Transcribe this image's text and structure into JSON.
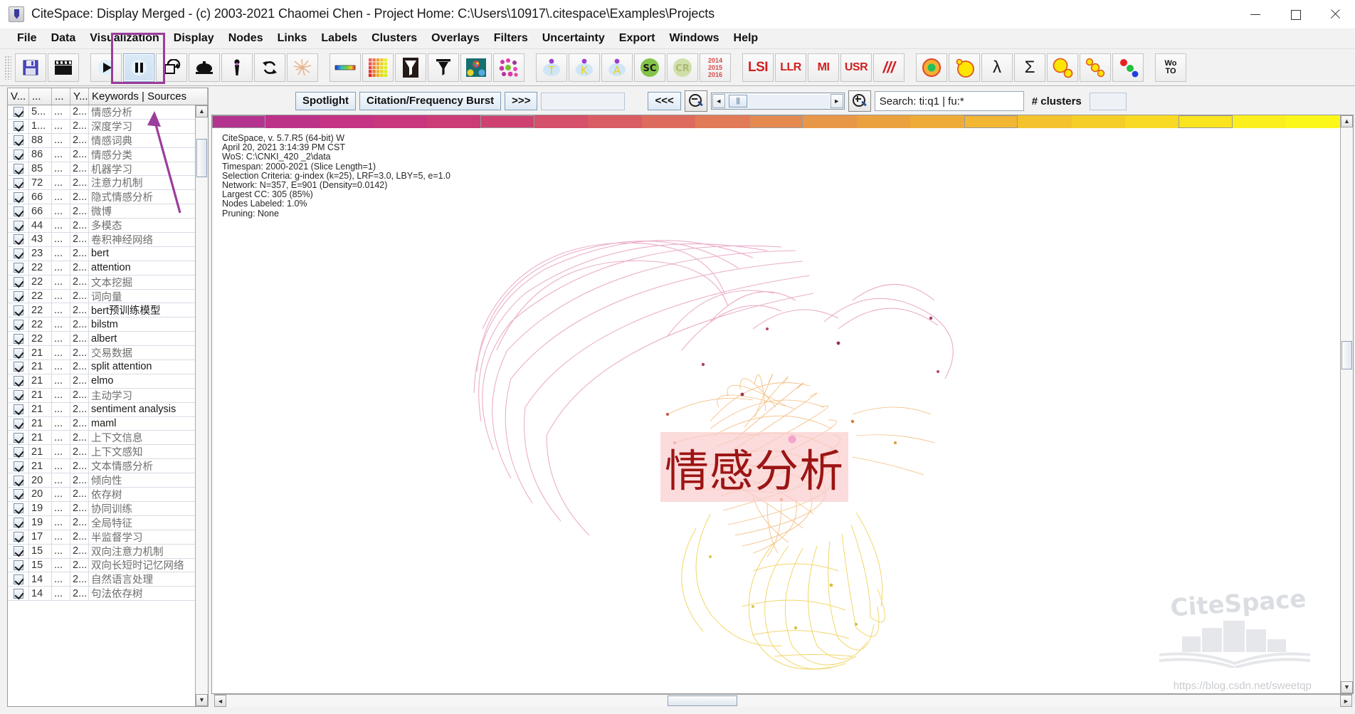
{
  "window": {
    "title": "CiteSpace: Display Merged - (c) 2003-2021 Chaomei Chen - Project Home: C:\\Users\\10917\\.citespace\\Examples\\Projects",
    "app_icon": "citespace-app-icon",
    "minimize": "–",
    "maximize": "□",
    "close": "✕"
  },
  "menubar": {
    "items": [
      {
        "label": "File"
      },
      {
        "label": "Data"
      },
      {
        "label": "Visualization"
      },
      {
        "label": "Display"
      },
      {
        "label": "Nodes"
      },
      {
        "label": "Links"
      },
      {
        "label": "Labels"
      },
      {
        "label": "Clusters"
      },
      {
        "label": "Overlays"
      },
      {
        "label": "Filters"
      },
      {
        "label": "Uncertainty"
      },
      {
        "label": "Export"
      },
      {
        "label": "Windows"
      },
      {
        "label": "Help"
      }
    ]
  },
  "toolbar": {
    "buttons": [
      {
        "name": "save-icon",
        "kind": "save"
      },
      {
        "name": "movie-clapper-icon",
        "kind": "movie"
      },
      {
        "name": "play-icon",
        "kind": "play"
      },
      {
        "name": "pause-icon",
        "kind": "pause",
        "pressed": true
      },
      {
        "name": "rotate-loop-icon",
        "kind": "loop"
      },
      {
        "name": "dome-icon",
        "kind": "dome"
      },
      {
        "name": "pin-icon",
        "kind": "pin"
      },
      {
        "name": "refresh-icon",
        "kind": "refresh"
      },
      {
        "name": "burst-starburst-icon",
        "kind": "starburst"
      },
      {
        "name": "color-gradient-bar-icon",
        "kind": "gradient"
      },
      {
        "name": "color-matrix-icon",
        "kind": "matrix"
      },
      {
        "name": "timeline-filled-icon",
        "kind": "funnel-filled"
      },
      {
        "name": "timeline-outline-icon",
        "kind": "funnel-outline"
      },
      {
        "name": "cluster-circles-icon",
        "kind": "clusters"
      },
      {
        "name": "network-dots-icon",
        "kind": "netdots"
      },
      {
        "name": "tree-t-icon",
        "label": "T"
      },
      {
        "name": "tree-k-icon",
        "label": "K"
      },
      {
        "name": "tree-a-icon",
        "label": "A"
      },
      {
        "name": "sc-badge-icon",
        "label": "SC"
      },
      {
        "name": "cr-badge-icon",
        "label": "CR"
      },
      {
        "name": "year-range-icon",
        "label": "2014\n2015\n2016"
      },
      {
        "name": "lsi-button",
        "label": "LSI"
      },
      {
        "name": "llr-button",
        "label": "LLR"
      },
      {
        "name": "mi-button",
        "label": "MI"
      },
      {
        "name": "usr-button",
        "label": "USR"
      },
      {
        "name": "slashes-button",
        "label": "///"
      },
      {
        "name": "node-ring-icon",
        "kind": "ring"
      },
      {
        "name": "node-circle-icon",
        "kind": "circle"
      },
      {
        "name": "lambda-button",
        "label": "λ"
      },
      {
        "name": "sigma-button",
        "label": "Σ"
      },
      {
        "name": "two-circles-icon",
        "kind": "twocircles"
      },
      {
        "name": "chain-circles-icon",
        "kind": "chain"
      },
      {
        "name": "rgb-dots-icon",
        "kind": "rgbdots"
      },
      {
        "name": "wos-toggle-button",
        "label": "Wo\nTO"
      }
    ]
  },
  "table": {
    "headers": [
      "V...",
      "...",
      "...",
      "Y...",
      "Keywords | Sources"
    ],
    "rows": [
      {
        "checked": true,
        "freq": "5...",
        "c2": "...",
        "year": "2...",
        "keyword": "情感分析",
        "latin": false
      },
      {
        "checked": true,
        "freq": "1...",
        "c2": "...",
        "year": "2...",
        "keyword": "深度学习",
        "latin": false
      },
      {
        "checked": true,
        "freq": "88",
        "c2": "...",
        "year": "2...",
        "keyword": "情感词典",
        "latin": false
      },
      {
        "checked": true,
        "freq": "86",
        "c2": "...",
        "year": "2...",
        "keyword": "情感分类",
        "latin": false
      },
      {
        "checked": true,
        "freq": "85",
        "c2": "...",
        "year": "2...",
        "keyword": "机器学习",
        "latin": false
      },
      {
        "checked": true,
        "freq": "72",
        "c2": "...",
        "year": "2...",
        "keyword": "注意力机制",
        "latin": false
      },
      {
        "checked": true,
        "freq": "66",
        "c2": "...",
        "year": "2...",
        "keyword": "隐式情感分析",
        "latin": false
      },
      {
        "checked": true,
        "freq": "66",
        "c2": "...",
        "year": "2...",
        "keyword": "微博",
        "latin": false
      },
      {
        "checked": true,
        "freq": "44",
        "c2": "...",
        "year": "2...",
        "keyword": "多模态",
        "latin": false
      },
      {
        "checked": true,
        "freq": "43",
        "c2": "...",
        "year": "2...",
        "keyword": "卷积神经网络",
        "latin": false
      },
      {
        "checked": true,
        "freq": "23",
        "c2": "...",
        "year": "2...",
        "keyword": "bert",
        "latin": true
      },
      {
        "checked": true,
        "freq": "22",
        "c2": "...",
        "year": "2...",
        "keyword": "attention",
        "latin": true
      },
      {
        "checked": true,
        "freq": "22",
        "c2": "...",
        "year": "2...",
        "keyword": "文本挖掘",
        "latin": false
      },
      {
        "checked": true,
        "freq": "22",
        "c2": "...",
        "year": "2...",
        "keyword": "词向量",
        "latin": false
      },
      {
        "checked": true,
        "freq": "22",
        "c2": "...",
        "year": "2...",
        "keyword": "bert预训练模型",
        "latin": true
      },
      {
        "checked": true,
        "freq": "22",
        "c2": "...",
        "year": "2...",
        "keyword": "bilstm",
        "latin": true
      },
      {
        "checked": true,
        "freq": "22",
        "c2": "...",
        "year": "2...",
        "keyword": "albert",
        "latin": true
      },
      {
        "checked": true,
        "freq": "21",
        "c2": "...",
        "year": "2...",
        "keyword": "交易数据",
        "latin": false
      },
      {
        "checked": true,
        "freq": "21",
        "c2": "...",
        "year": "2...",
        "keyword": "split attention",
        "latin": true
      },
      {
        "checked": true,
        "freq": "21",
        "c2": "...",
        "year": "2...",
        "keyword": "elmo",
        "latin": true
      },
      {
        "checked": true,
        "freq": "21",
        "c2": "...",
        "year": "2...",
        "keyword": "主动学习",
        "latin": false
      },
      {
        "checked": true,
        "freq": "21",
        "c2": "...",
        "year": "2...",
        "keyword": "sentiment analysis",
        "latin": true
      },
      {
        "checked": true,
        "freq": "21",
        "c2": "...",
        "year": "2...",
        "keyword": "maml",
        "latin": true
      },
      {
        "checked": true,
        "freq": "21",
        "c2": "...",
        "year": "2...",
        "keyword": "上下文信息",
        "latin": false
      },
      {
        "checked": true,
        "freq": "21",
        "c2": "...",
        "year": "2...",
        "keyword": "上下文感知",
        "latin": false
      },
      {
        "checked": true,
        "freq": "21",
        "c2": "...",
        "year": "2...",
        "keyword": "文本情感分析",
        "latin": false
      },
      {
        "checked": true,
        "freq": "20",
        "c2": "...",
        "year": "2...",
        "keyword": "倾向性",
        "latin": false
      },
      {
        "checked": true,
        "freq": "20",
        "c2": "...",
        "year": "2...",
        "keyword": "依存树",
        "latin": false
      },
      {
        "checked": true,
        "freq": "19",
        "c2": "...",
        "year": "2...",
        "keyword": "协同训练",
        "latin": false
      },
      {
        "checked": true,
        "freq": "19",
        "c2": "...",
        "year": "2...",
        "keyword": "全局特征",
        "latin": false
      },
      {
        "checked": true,
        "freq": "17",
        "c2": "...",
        "year": "2...",
        "keyword": "半监督学习",
        "latin": false
      },
      {
        "checked": true,
        "freq": "15",
        "c2": "...",
        "year": "2...",
        "keyword": "双向注意力机制",
        "latin": false
      },
      {
        "checked": true,
        "freq": "15",
        "c2": "...",
        "year": "2...",
        "keyword": "双向长短时记忆网络",
        "latin": false
      },
      {
        "checked": true,
        "freq": "14",
        "c2": "...",
        "year": "2...",
        "keyword": "自然语言处理",
        "latin": false
      },
      {
        "checked": true,
        "freq": "14",
        "c2": "...",
        "year": "2...",
        "keyword": "句法依存树",
        "latin": false
      }
    ]
  },
  "controlbar": {
    "spotlight_label": "Spotlight",
    "burst_label": "Citation/Frequency Burst",
    "forward_label": ">>>",
    "back_label": "<<<",
    "field_value": "",
    "zoom_out_icon": "zoom-out-icon",
    "zoom_in_icon": "zoom-in-icon",
    "slider_left_arrow": "◄",
    "slider_right_arrow": "►",
    "search_value": "Search: ti:q1 | fu:*",
    "clusters_label": "# clusters",
    "clusters_value": ""
  },
  "graph": {
    "info_lines": [
      "CiteSpace, v. 5.7.R5 (64-bit) W",
      "April 20, 2021 3:14:39 PM CST",
      "WoS: C:\\CNKI_420 _2\\data",
      "Timespan: 2000-2021 (Slice Length=1)",
      "Selection Criteria: g-index (k=25), LRF=3.0, LBY=5, e=1.0",
      "Network: N=357, E=901 (Density=0.0142)",
      "Largest CC: 305 (85%)",
      "Nodes Labeled: 1.0%",
      "Pruning: None"
    ],
    "node_label": "情感分析",
    "watermark_text": "CiteSpace",
    "csdn_watermark": "https://blog.csdn.net/sweetqp",
    "spectrum_colors": [
      "#b4338f",
      "#bd3289",
      "#c43384",
      "#c8377d",
      "#cb3c76",
      "#cf4170",
      "#d5506b",
      "#d95b64",
      "#dc6b5e",
      "#e07a57",
      "#e58a4f",
      "#e89647",
      "#eca13f",
      "#efab38",
      "#f2b633",
      "#f4c22d",
      "#f6ce28",
      "#f8d924",
      "#fae420",
      "#fbef1d",
      "#fcf71b"
    ],
    "spectrum_marked_indexes": [
      0,
      5,
      10,
      14,
      18
    ]
  },
  "scrollbars": {
    "up_arrow": "▲",
    "down_arrow": "▼",
    "left_arrow": "◄",
    "right_arrow": "►"
  }
}
